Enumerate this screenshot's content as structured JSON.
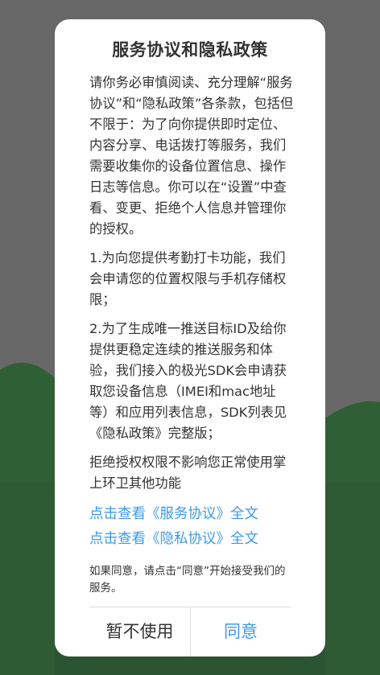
{
  "dialog": {
    "title": "服务协议和隐私政策",
    "intro": "请你务必审慎阅读、充分理解“服务协议”和“隐私政策”各条款，包括但不限于：为了向你提供即时定位、内容分享、电话拨打等服务，我们需要收集你的设备位置信息、操作日志等信息。你可以在“设置”中查看、变更、拒绝个人信息并管理你的授权。",
    "item1": "1.为向您提供考勤打卡功能，我们会申请您的位置权限与手机存储权限；",
    "item2": "2.为了生成唯一推送目标ID及给你提供更稳定连续的推送服务和体验，我们接入的极光SDK会申请获取您设备信息（IMEI和mac地址等）和应用列表信息，SDK列表见《隐私政策》完整版；",
    "refuse_text": "拒绝授权权限不影响您正常使用掌上环卫其他功能",
    "link_service": "点击查看《服务协议》全文",
    "link_privacy": "点击查看《隐私协议》全文",
    "note": "如果同意，请点击“同意”开始接受我们的服务。",
    "decline_label": "暂不使用",
    "agree_label": "同意"
  },
  "colors": {
    "accent": "#3d9be9",
    "text": "#333333",
    "overlay": "#676767",
    "hill": "#2b5a32"
  }
}
